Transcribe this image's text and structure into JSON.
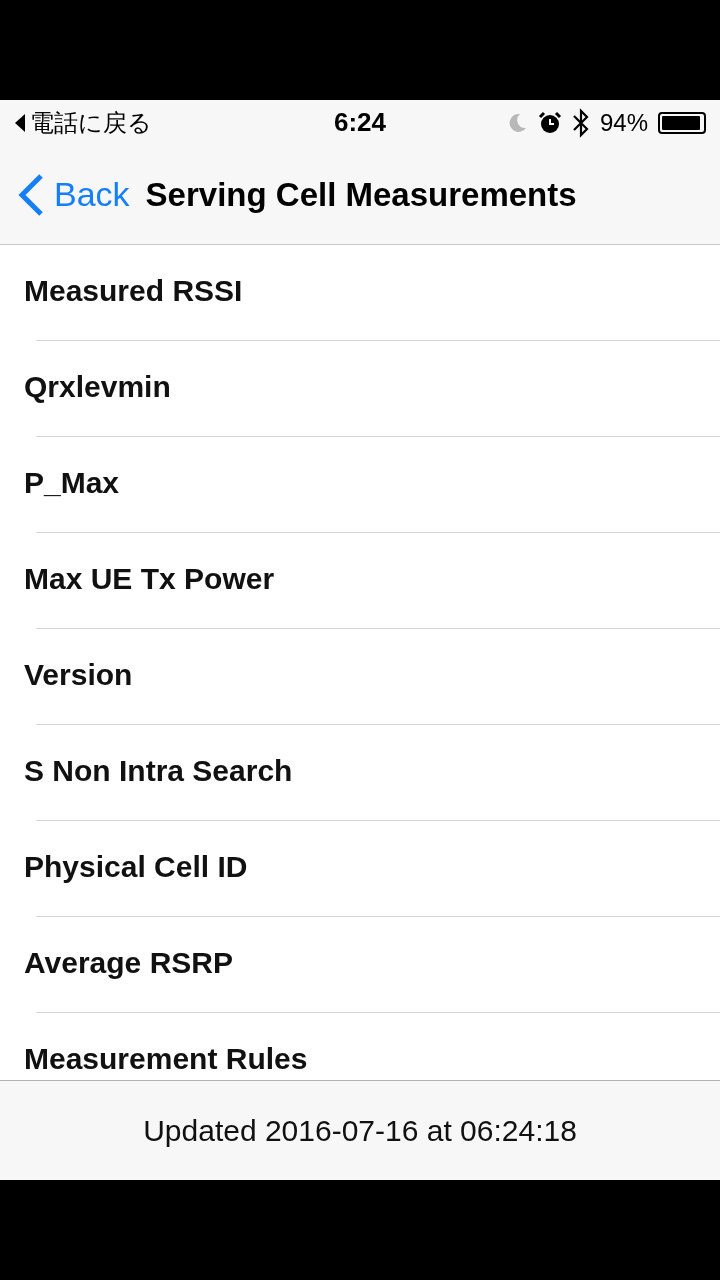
{
  "status_bar": {
    "back_to_app": "電話に戻る",
    "time": "6:24",
    "battery": "94%",
    "battery_icon": {
      "level": 0.94
    }
  },
  "nav_bar": {
    "back": "Back",
    "title": "Serving Cell Measurements"
  },
  "rows": [
    {
      "label": "Measured RSSI"
    },
    {
      "label": "Qrxlevmin"
    },
    {
      "label": "P_Max"
    },
    {
      "label": "Max UE Tx Power"
    },
    {
      "label": "Version"
    },
    {
      "label": "S Non Intra Search"
    },
    {
      "label": "Physical Cell ID"
    },
    {
      "label": "Average RSRP"
    },
    {
      "label": "Measurement Rules"
    }
  ],
  "toolbar": {
    "updated": "Updated 2016-07-16 at 06:24:18"
  }
}
